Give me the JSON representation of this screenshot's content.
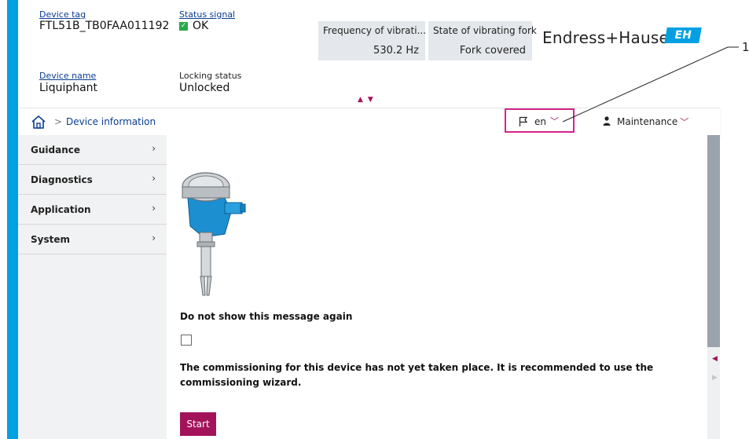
{
  "header": {
    "device_tag_label": "Device tag",
    "device_tag_value": "FTL51B_TB0FAA011192",
    "status_signal_label": "Status signal",
    "status_signal_value": "OK",
    "device_name_label": "Device name",
    "device_name_value": "Liquiphant",
    "locking_status_label": "Locking status",
    "locking_status_value": "Unlocked",
    "tiles": [
      {
        "label": "Frequency of vibrati...",
        "value": "530.2 Hz"
      },
      {
        "label": "State of vibrating fork",
        "value": "Fork covered"
      }
    ],
    "brand": "Endress+Hauser",
    "brand_logo": "EH",
    "collapse_arrows": "▲▼"
  },
  "navbar": {
    "breadcrumb_sep": ">",
    "breadcrumb": "Device information",
    "language": "en",
    "user_role": "Maintenance"
  },
  "sidebar": {
    "items": [
      {
        "label": "Guidance"
      },
      {
        "label": "Diagnostics"
      },
      {
        "label": "Application"
      },
      {
        "label": "System"
      }
    ]
  },
  "content": {
    "message_dont_show": "Do not show this message again",
    "message_commissioning": "The commissioning for this device has not yet taken place. It is recommended to use the commissioning wizard.",
    "start_button": "Start"
  },
  "callout": {
    "number": "1"
  },
  "colors": {
    "accent": "#00a0e3",
    "brand_magenta": "#a2135a",
    "highlight": "#d6248a",
    "ok_green": "#2aa84a"
  }
}
